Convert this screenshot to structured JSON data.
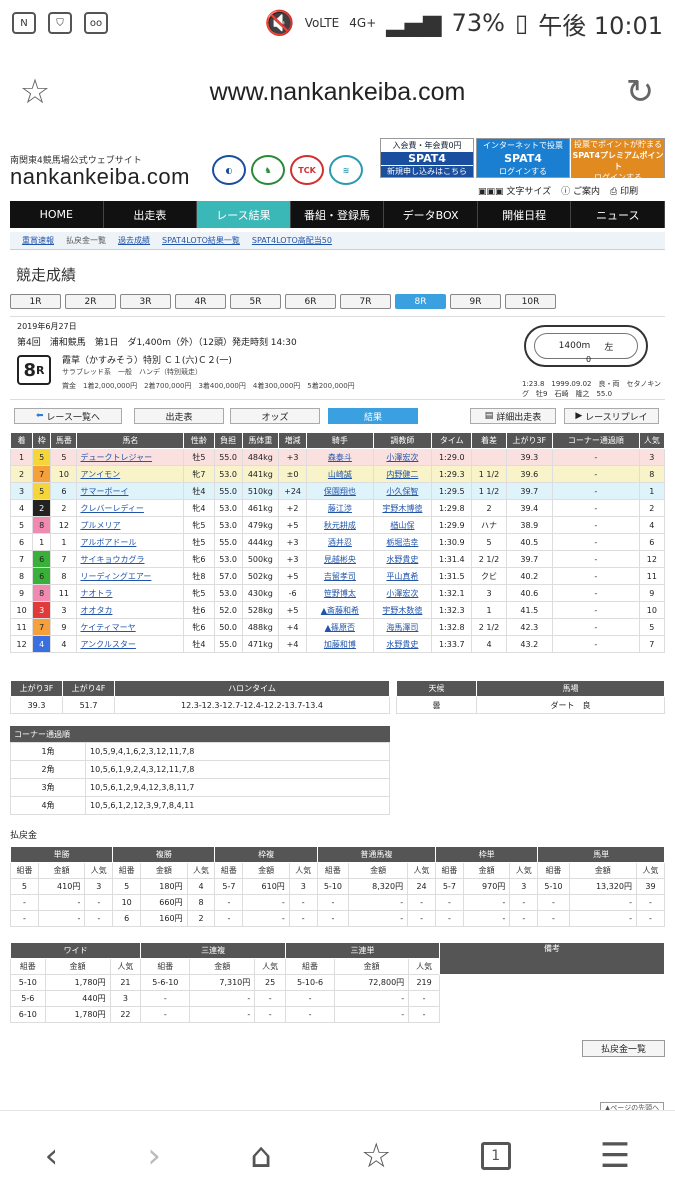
{
  "status": {
    "left_icons": [
      "nfc-on-icon",
      "vpn-icon",
      "voicemail-icon"
    ],
    "battery": "73%",
    "time": "午後 10:01",
    "network": "4G+"
  },
  "browser": {
    "url": "www.nankankeiba.com"
  },
  "site": {
    "subtitle": "南関東4競馬場公式ウェブサイト",
    "logo": "nankankeiba.com",
    "banners": [
      {
        "top": "入会費・年会費0円",
        "main": "SPAT4",
        "bottom": "新規申し込みはこちら"
      },
      {
        "top": "インターネットで投票",
        "main": "SPAT4",
        "bottom": "ログインする"
      },
      {
        "top": "投票でポイントが貯まる",
        "main": "SPAT4プレミアムポイント",
        "bottom": "ログインする"
      }
    ],
    "tools": [
      "文字サイズ",
      "ご案内",
      "印刷"
    ]
  },
  "nav": [
    "HOME",
    "出走表",
    "レース結果",
    "番組・登録馬",
    "データBOX",
    "開催日程",
    "ニュース"
  ],
  "subnav": [
    "重賞速報",
    "払戻金一覧",
    "過去成績",
    "SPAT4LOTO結果一覧",
    "SPAT4LOTO高配当50"
  ],
  "page_title": "競走成績",
  "race_tabs": [
    "1R",
    "2R",
    "3R",
    "4R",
    "5R",
    "6R",
    "7R",
    "8R",
    "9R",
    "10R"
  ],
  "race": {
    "date": "2019年6月27日",
    "meet": "第4回　浦和競馬　第1日　ダ1,400m（外）（12頭）発走時刻 14:30",
    "number": "8",
    "number_suffix": "R",
    "name": "霞草（かすみそう）特別 Ｃ１(六)Ｃ２(一)",
    "class": "サラブレッド系　一般　ハンデ（特別競走）",
    "prize": "賞金　1着2,000,000円　2着700,000円　3着400,000円　4着300,000円　5着200,000円",
    "course_distance": "1400m",
    "course_dir": "左",
    "course_start": "0",
    "record": "1:23.8　1999.09.02　良・両　セタノキング　牡9　石崎　隆之　55.0"
  },
  "buttons": {
    "back": "レース一覧へ",
    "entries": "出走表",
    "odds": "オッズ",
    "results": "結果",
    "detail": "詳細出走表",
    "replay": "レースリプレイ"
  },
  "results_headers": [
    "着",
    "枠",
    "馬番",
    "馬名",
    "性齢",
    "負担",
    "馬体重",
    "増減",
    "騎手",
    "調教師",
    "タイム",
    "着差",
    "上がり3F",
    "コーナー通過順",
    "人気"
  ],
  "results": [
    [
      "1",
      "5",
      "5",
      "デュークトレジャー",
      "牡5",
      "55.0",
      "484kg",
      "+3",
      "森泰斗",
      "小澤宏次",
      "1:29.0",
      "",
      "39.3",
      "-",
      "3"
    ],
    [
      "2",
      "7",
      "10",
      "アンイモン",
      "牝7",
      "53.0",
      "441kg",
      "±0",
      "山崎誠",
      "内野健二",
      "1:29.3",
      "1 1/2",
      "39.6",
      "-",
      "8"
    ],
    [
      "3",
      "5",
      "6",
      "サマーボーイ",
      "牡4",
      "55.0",
      "510kg",
      "+24",
      "保園翔也",
      "小久保智",
      "1:29.5",
      "1 1/2",
      "39.7",
      "-",
      "1"
    ],
    [
      "4",
      "2",
      "2",
      "クレバーレディー",
      "牝4",
      "53.0",
      "461kg",
      "+2",
      "藤江渉",
      "宇野木博徳",
      "1:29.8",
      "2",
      "39.4",
      "-",
      "2"
    ],
    [
      "5",
      "8",
      "12",
      "プルメリア",
      "牝5",
      "53.0",
      "479kg",
      "+5",
      "秋元耕成",
      "楢山保",
      "1:29.9",
      "ハナ",
      "38.9",
      "-",
      "4"
    ],
    [
      "6",
      "1",
      "1",
      "アルボアドール",
      "牡5",
      "55.0",
      "444kg",
      "+3",
      "酒井忍",
      "栃堀浩幸",
      "1:30.9",
      "5",
      "40.5",
      "-",
      "6"
    ],
    [
      "7",
      "6",
      "7",
      "サイキョウカグラ",
      "牝6",
      "53.0",
      "500kg",
      "+3",
      "見越彬央",
      "水野貴史",
      "1:31.4",
      "2 1/2",
      "39.7",
      "-",
      "12"
    ],
    [
      "8",
      "6",
      "8",
      "リーディングエアー",
      "牡8",
      "57.0",
      "502kg",
      "+5",
      "吉留孝司",
      "平山真希",
      "1:31.5",
      "クビ",
      "40.2",
      "-",
      "11"
    ],
    [
      "9",
      "8",
      "11",
      "ナオトラ",
      "牝5",
      "53.0",
      "430kg",
      "-6",
      "笹野博太",
      "小澤宏次",
      "1:32.1",
      "3",
      "40.6",
      "-",
      "9"
    ],
    [
      "10",
      "3",
      "3",
      "オオタカ",
      "牡6",
      "52.0",
      "528kg",
      "+5",
      "▲斎藤和希",
      "宇野木数徳",
      "1:32.3",
      "1",
      "41.5",
      "-",
      "10"
    ],
    [
      "11",
      "7",
      "9",
      "ケイティマーヤ",
      "牝6",
      "50.0",
      "488kg",
      "+4",
      "▲篠原否",
      "海馬澤司",
      "1:32.8",
      "2 1/2",
      "42.3",
      "-",
      "5"
    ],
    [
      "12",
      "4",
      "4",
      "アンクルスター",
      "牡4",
      "55.0",
      "471kg",
      "+4",
      "加藤和博",
      "水野貴史",
      "1:33.7",
      "4",
      "43.2",
      "-",
      "7"
    ]
  ],
  "waku_colors": {
    "1": "#ffffff",
    "2": "#222222",
    "3": "#e03a3a",
    "4": "#3a6fe0",
    "5": "#f5d63a",
    "6": "#3ab03a",
    "7": "#f5a03a",
    "8": "#f08ab0"
  },
  "row_highlight": [
    "#fbe0e0",
    "#f8f3c8",
    "#dff3fb"
  ],
  "agari": {
    "headers": [
      "上がり3F",
      "上がり4F",
      "ハロンタイム"
    ],
    "values": [
      "39.3",
      "51.7",
      "12.3-12.3-12.7-12.4-12.2-13.7-13.4"
    ]
  },
  "conditions": {
    "headers": [
      "天候",
      "馬場"
    ],
    "values": [
      "曇",
      "ダート　良"
    ]
  },
  "corner": {
    "title": "コーナー通過順",
    "rows": [
      [
        "1角",
        "10,5,9,4,1,6,2,3,12,11,7,8"
      ],
      [
        "2角",
        "10,5,6,1,9,2,4,3,12,11,7,8"
      ],
      [
        "3角",
        "10,5,6,1,2,9,4,12,3,8,11,7"
      ],
      [
        "4角",
        "10,5,6,1,2,12,3,9,7,8,4,11"
      ]
    ]
  },
  "payout_title": "払戻金",
  "payout1": {
    "groups": [
      "単勝",
      "複勝",
      "枠複",
      "普通馬複",
      "枠単",
      "馬単"
    ],
    "sub": [
      "組番",
      "金額",
      "人気"
    ],
    "rows": [
      [
        "5",
        "410円",
        "3",
        "5",
        "180円",
        "4",
        "5-7",
        "610円",
        "3",
        "5-10",
        "8,320円",
        "24",
        "5-7",
        "970円",
        "3",
        "5-10",
        "13,320円",
        "39"
      ],
      [
        "-",
        "-",
        "-",
        "10",
        "660円",
        "8",
        "-",
        "-",
        "-",
        "-",
        "-",
        "-",
        "-",
        "-",
        "-",
        "-",
        "-",
        "-"
      ],
      [
        "-",
        "-",
        "-",
        "6",
        "160円",
        "2",
        "-",
        "-",
        "-",
        "-",
        "-",
        "-",
        "-",
        "-",
        "-",
        "-",
        "-",
        "-"
      ]
    ]
  },
  "payout2": {
    "groups": [
      "ワイド",
      "三連複",
      "三連単",
      "備考"
    ],
    "sub": [
      "組番",
      "金額",
      "人気"
    ],
    "rows": [
      [
        "5-10",
        "1,780円",
        "21",
        "5-6-10",
        "7,310円",
        "25",
        "5-10-6",
        "72,800円",
        "219"
      ],
      [
        "5-6",
        "440円",
        "3",
        "-",
        "-",
        "-",
        "-",
        "-",
        "-"
      ],
      [
        "6-10",
        "1,780円",
        "22",
        "-",
        "-",
        "-",
        "-",
        "-",
        "-"
      ]
    ]
  },
  "payout_list_button": "払戻金一覧",
  "page_top": "▲ページの先頭へ",
  "bottom_nav": {
    "tab_count": "1"
  }
}
